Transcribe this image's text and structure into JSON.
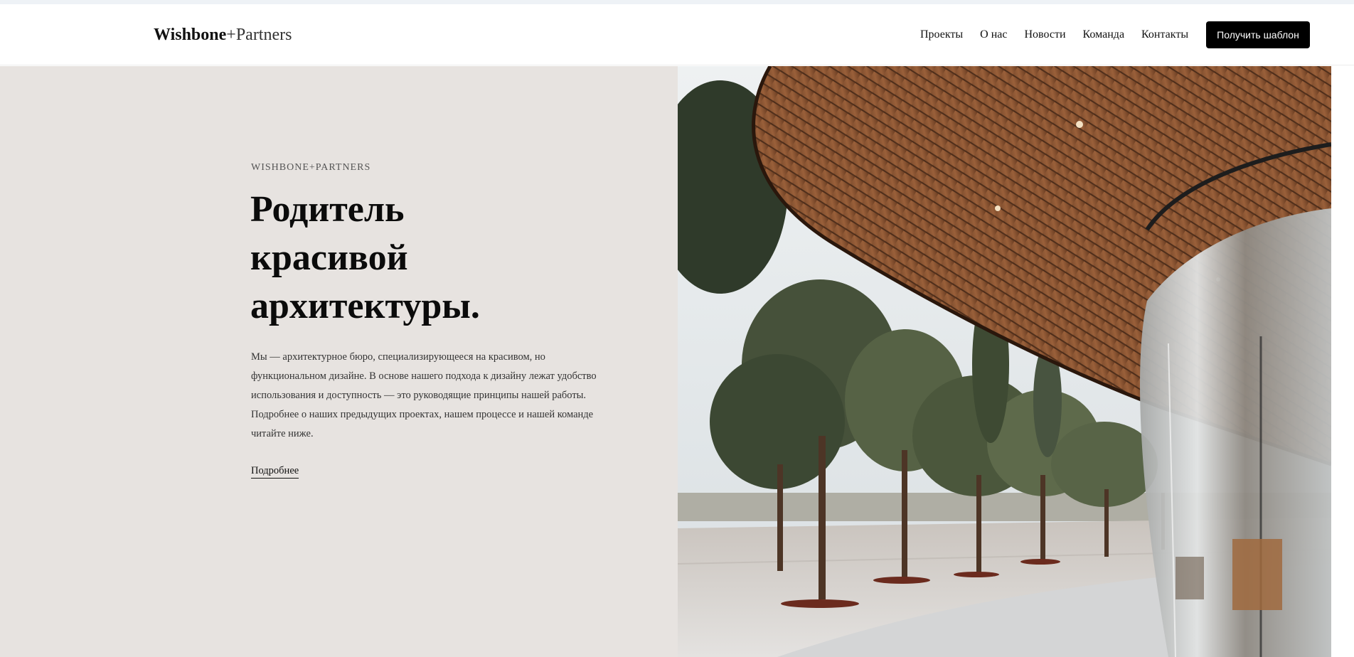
{
  "brand": {
    "name_bold": "Wishbone",
    "name_light": "+Partners"
  },
  "nav": {
    "items": [
      "Проекты",
      "О нас",
      "Новости",
      "Команда",
      "Контакты"
    ],
    "cta_label": "Получить шаблон"
  },
  "hero": {
    "eyebrow": "WISHBONE+PARTNERS",
    "title_lines": [
      "Родитель",
      "красивой",
      "архитектуры."
    ],
    "description": "Мы — архитектурное бюро, специализирующееся на красивом, но функциональном дизайне. В основе нашего подхода к дизайну лежат удобство использования и доступность — это руководящие принципы нашей работы. Подробнее о наших предыдущих проектах, нашем процессе и нашей команде читайте ниже.",
    "link_label": "Подробнее"
  },
  "colors": {
    "hero_background": "#e7e3e0",
    "cta_background": "#000000",
    "text": "#0b0b0b"
  }
}
